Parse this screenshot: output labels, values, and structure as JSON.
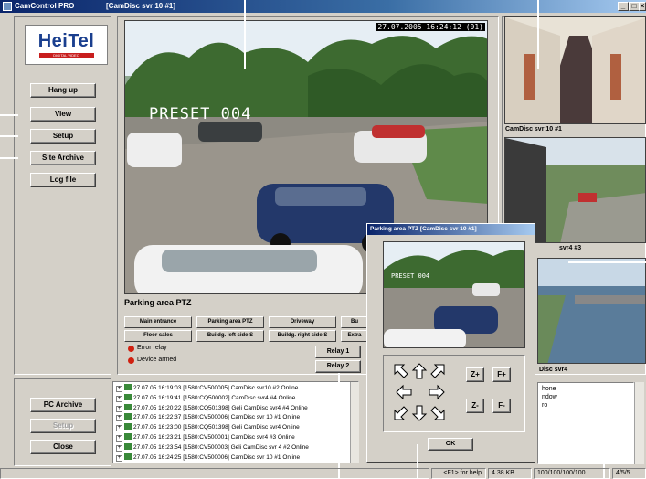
{
  "window": {
    "app_title": "CamControl PRO",
    "doc_title": "[CamDisc svr 10 #1]",
    "min_label": "_",
    "max_label": "□",
    "close_label": "×"
  },
  "brand": {
    "logo": "HeiTel",
    "tagline": "DIGITAL VIDEO"
  },
  "sidebar": {
    "buttons": [
      "Hang up",
      "View",
      "Setup",
      "Site Archive",
      "Log file"
    ]
  },
  "main_camera": {
    "timestamp": "27.07.2005 16:24:12 (01)",
    "preset_label": "PRESET 004"
  },
  "zones": {
    "title": "Parking area PTZ",
    "buttons": [
      "Main entrance",
      "Parking area PTZ",
      "Driveway",
      "Bu",
      "Floor sales",
      "Buildg. left side S",
      "Buildg. right side S",
      "Extra"
    ]
  },
  "status_lights": [
    {
      "label": "Error relay",
      "color": "#d02010"
    },
    {
      "label": "Device armed",
      "color": "#d02010"
    }
  ],
  "relays": [
    "Relay 1",
    "Relay 2"
  ],
  "bottom_buttons": {
    "archive": "PC Archive",
    "setup": "Setup",
    "close": "Close"
  },
  "log": [
    "27.07.05 16:19:03 [1580:CV500005] CamDisc svr10 #2 Online",
    "27.07.05 16:19:41 [1580:CQ500002] CamDisc svr4 #4 Online",
    "27.07.05 16:20:22 [1580:CQ501398] Geli CamDisc svr4 #4 Online",
    "27.07.05 16:22:37 [1580:CV500006] CamDisc svr 10 #1 Online",
    "27.07.05 16:23:00 [1580:CQ501398] Geli CamDisc svr4 Online",
    "27.07.05 16:23:21 [1580:CV500001] CamDisc svr4 #3 Online",
    "27.07.05 16:23:54 [1580:CV500003] Geli CamDisc svr 4 #2 Online",
    "27.07.05 16:24:25 [1580:CV500006] CamDisc svr 10 #1 Online"
  ],
  "right_cams": {
    "cam1_caption": "CamDisc svr 10 #1",
    "cam2_caption": "svr4 #3",
    "cam3_caption": "Disc svr4"
  },
  "right_info": [
    "hone",
    "ndow",
    "ro"
  ],
  "ptz_dialog": {
    "title": "Parking area PTZ [CamDisc svr 10 #1]",
    "zoom_in": "Z+",
    "focus_in": "F+",
    "zoom_out": "Z-",
    "focus_out": "F-",
    "ok": "OK",
    "directions": [
      "up-left",
      "up",
      "up-right",
      "left",
      "right",
      "down-left",
      "down",
      "down-right"
    ]
  },
  "statusbar": {
    "help": "<F1> for help",
    "size": "4.38 KB",
    "rate": "100/100/100/100",
    "page": "4/5/5"
  },
  "colors": {
    "titlebar": "#0a246a",
    "face": "#d4d0c8",
    "brand_red": "#c81e1e",
    "brand_blue": "#1a3f8f"
  }
}
